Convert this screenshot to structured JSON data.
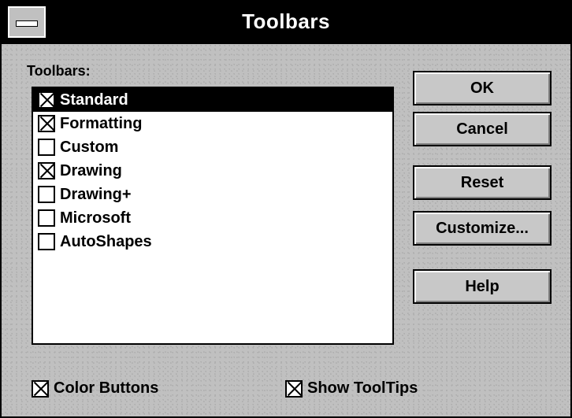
{
  "window": {
    "title": "Toolbars"
  },
  "toolbars_group": {
    "label": "Toolbars:",
    "items": [
      {
        "label": "Standard",
        "checked": true,
        "selected": true
      },
      {
        "label": "Formatting",
        "checked": true,
        "selected": false
      },
      {
        "label": "Custom",
        "checked": false,
        "selected": false
      },
      {
        "label": "Drawing",
        "checked": true,
        "selected": false
      },
      {
        "label": "Drawing+",
        "checked": false,
        "selected": false
      },
      {
        "label": "Microsoft",
        "checked": false,
        "selected": false
      },
      {
        "label": "AutoShapes",
        "checked": false,
        "selected": false
      }
    ]
  },
  "buttons": {
    "ok": "OK",
    "cancel": "Cancel",
    "reset": "Reset",
    "customize": "Customize...",
    "help": "Help"
  },
  "options": {
    "color_buttons": {
      "label": "Color Buttons",
      "checked": true
    },
    "show_tooltips": {
      "label": "Show ToolTips",
      "checked": true
    }
  },
  "icons": {
    "system_menu": "system-menu-icon"
  }
}
